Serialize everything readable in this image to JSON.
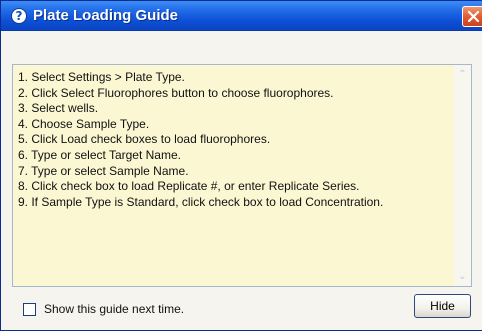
{
  "window": {
    "title": "Plate Loading Guide",
    "title_icon": "question-circle-icon",
    "close_icon": "close-icon",
    "accent_color": "#1f69e6",
    "close_color": "#e25c33",
    "panel_background": "#fbf7d3"
  },
  "guide": {
    "steps": [
      "1. Select Settings > Plate Type.",
      "2. Click Select Fluorophores button to choose fluorophores.",
      "3. Select wells.",
      "4. Choose Sample Type.",
      "5. Click Load check boxes to load fluorophores.",
      "6. Type or select Target Name.",
      "7. Type or select Sample Name.",
      "8. Click check box to load Replicate #, or enter Replicate Series.",
      "9. If Sample Type is Standard, click check box to load Concentration."
    ]
  },
  "footer": {
    "checkbox_label": "Show this guide next time.",
    "checkbox_checked": false,
    "hide_label": "Hide"
  }
}
